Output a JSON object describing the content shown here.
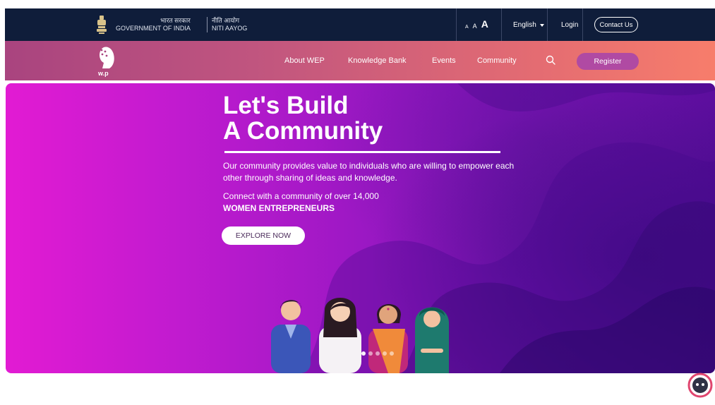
{
  "gov_bar": {
    "hindi_gov": "भारत सरकार",
    "gov_label": "GOVERNMENT OF INDIA",
    "hindi_niti": "नीति आयोग",
    "niti_label": "NITI AAYOG",
    "font_small": "A",
    "font_mid": "A",
    "font_big": "A",
    "language": "English",
    "login": "Login",
    "contact": "Contact Us"
  },
  "nav": {
    "logo_text": "w.p",
    "items": [
      {
        "label": "About WEP"
      },
      {
        "label": "Knowledge Bank"
      },
      {
        "label": "Events"
      },
      {
        "label": "Community"
      }
    ],
    "register": "Register"
  },
  "hero": {
    "title_line1": "Let's Build",
    "title_line2": "A Community",
    "description": "Our community provides value to individuals who are willing to empower each other through sharing of ideas and knowledge.",
    "connect": "Connect with a community of over 14,000",
    "connect_strong": "WOMEN ENTREPRENEURS",
    "cta": "EXPLORE NOW",
    "slide_count": 5,
    "active_slide": 1
  },
  "colors": {
    "gov_bar": "#0f1d3a",
    "nav_start": "#a9447f",
    "nav_end": "#f77d6b",
    "register": "#b04aa3",
    "hero_start": "#e21bd3",
    "hero_end": "#5c0d9e"
  },
  "icons": [
    "emblem-icon",
    "wep-logo",
    "search-icon",
    "chat-bot-icon",
    "caret-down-icon"
  ]
}
